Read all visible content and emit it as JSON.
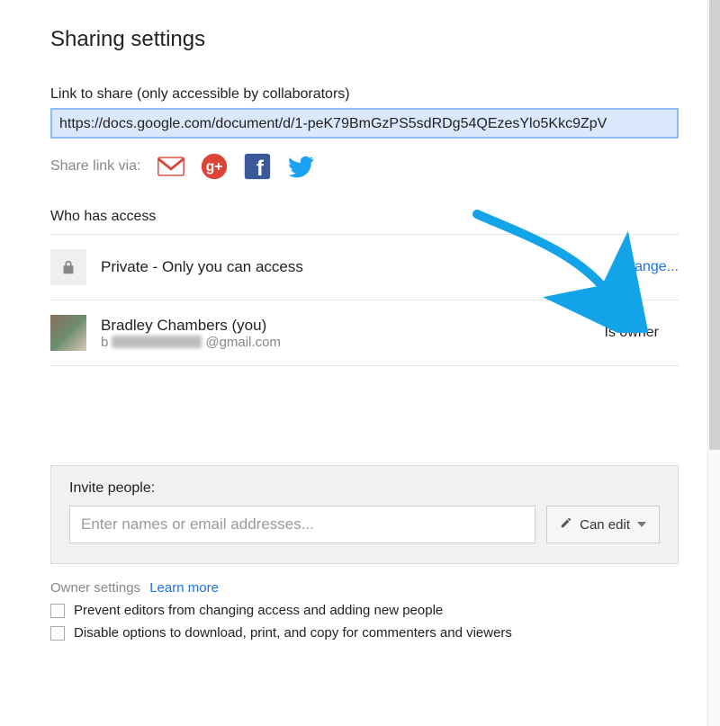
{
  "title": "Sharing settings",
  "link": {
    "label": "Link to share (only accessible by collaborators)",
    "value": "https://docs.google.com/document/d/1-peK79BmGzPS5sdRDg54QEzesYlo5Kkc9ZpV"
  },
  "share_via_label": "Share link via:",
  "access": {
    "heading": "Who has access",
    "privacy_text": "Private - Only you can access",
    "change_label": "Change...",
    "person": {
      "name": "Bradley Chambers (you)",
      "email_prefix": "b",
      "email_domain": "@gmail.com",
      "role": "Is owner"
    }
  },
  "invite": {
    "title": "Invite people:",
    "placeholder": "Enter names or email addresses...",
    "permission_label": "Can edit"
  },
  "owner_settings": {
    "heading": "Owner settings",
    "learn_more": "Learn more",
    "option1": "Prevent editors from changing access and adding new people",
    "option2": "Disable options to download, print, and copy for commenters and viewers"
  }
}
